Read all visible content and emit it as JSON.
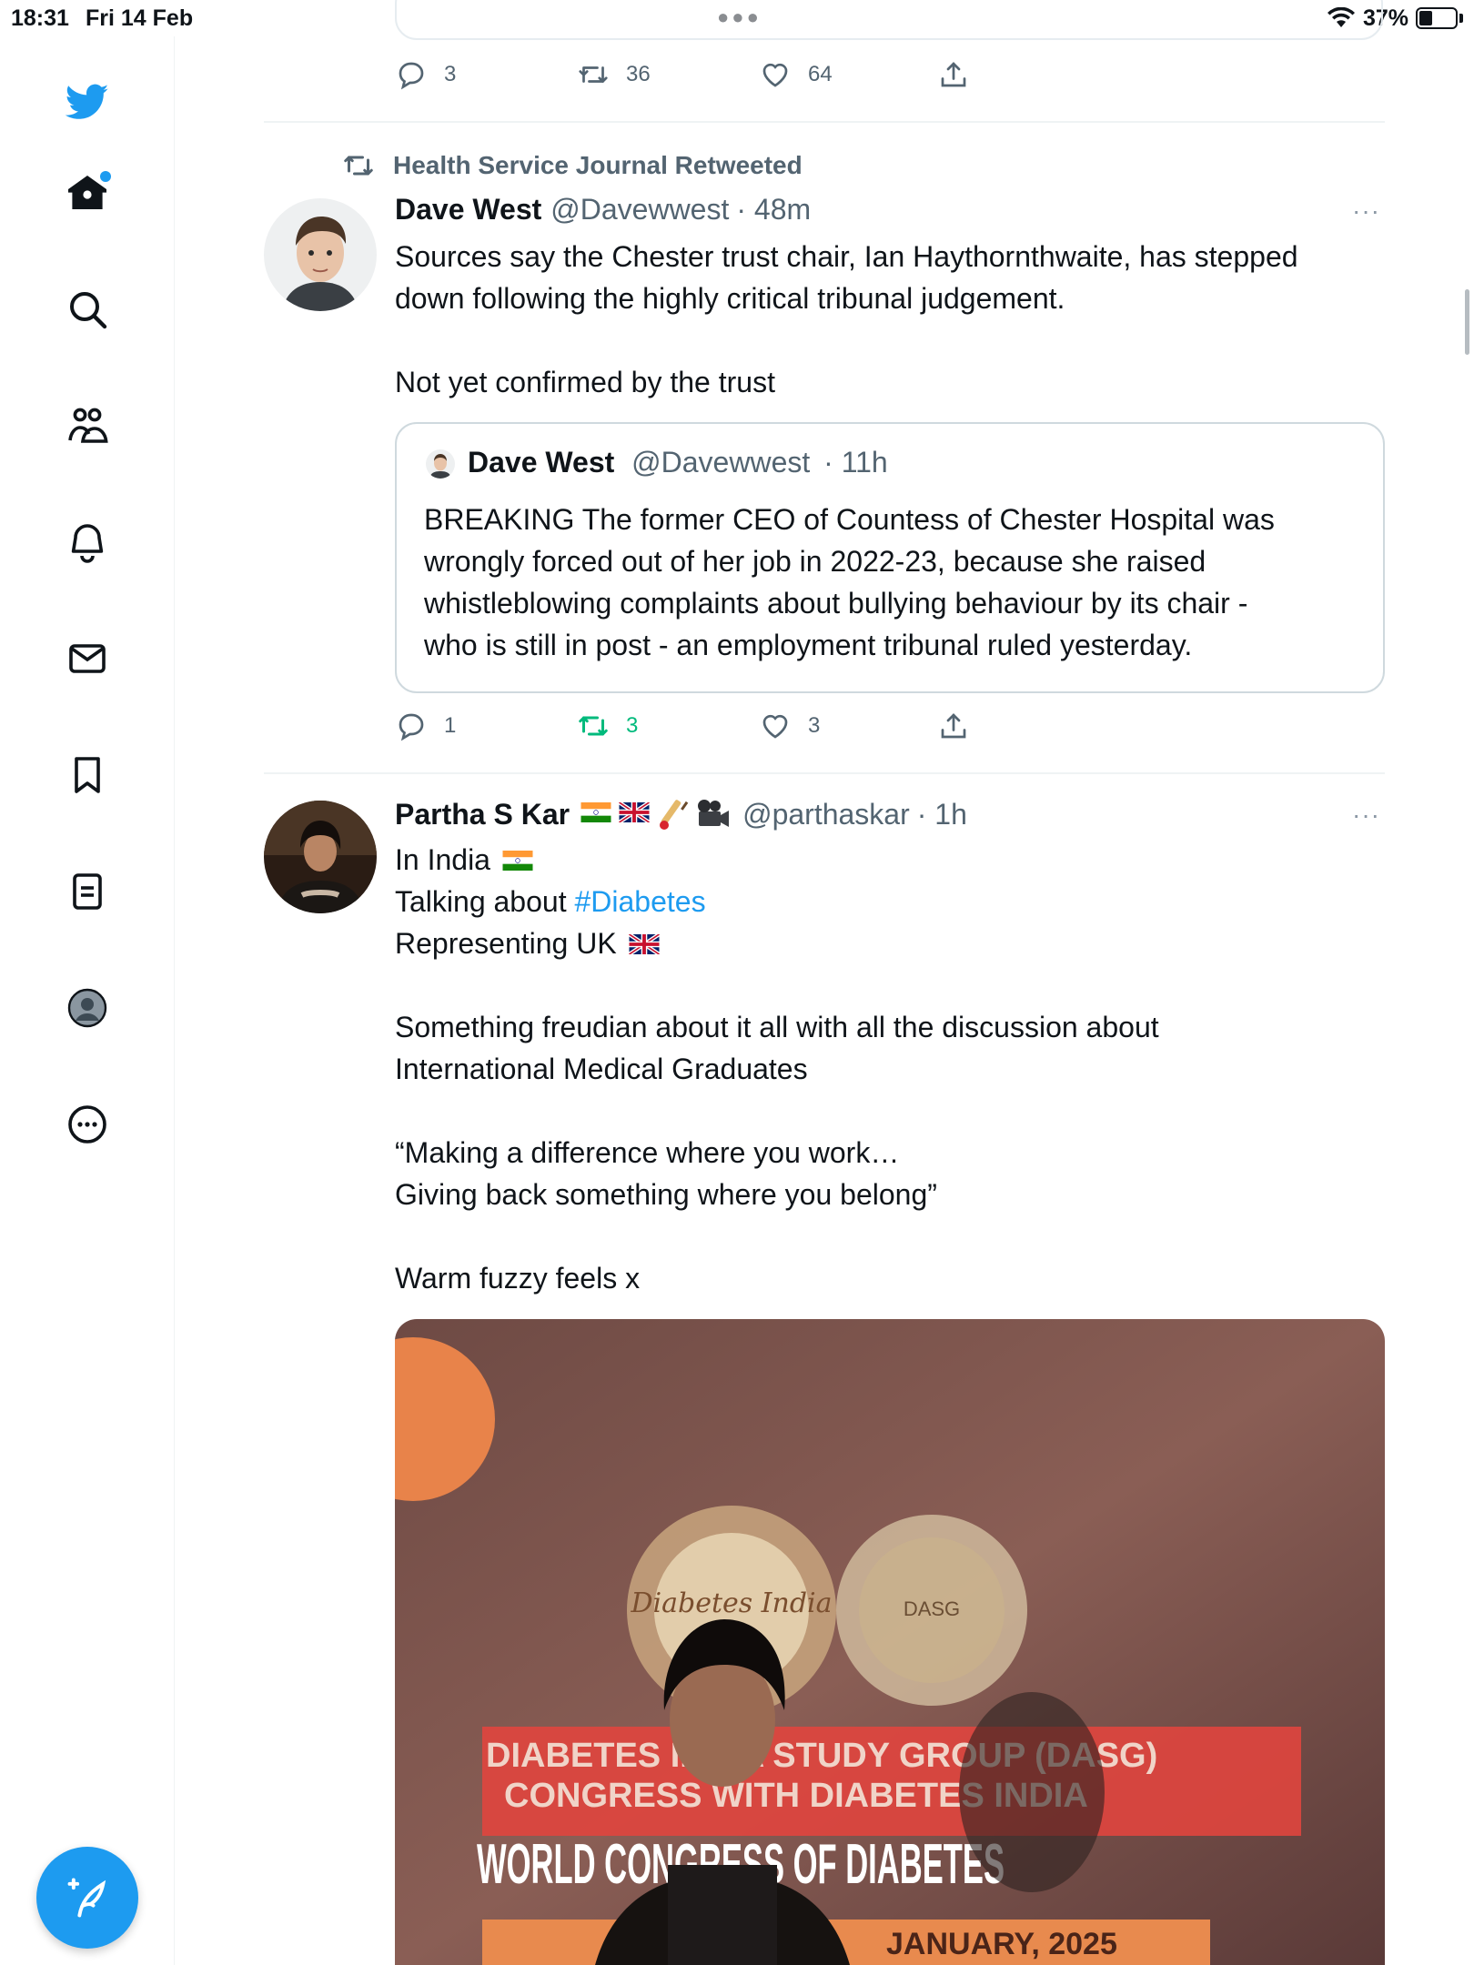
{
  "status_bar": {
    "time": "18:31",
    "date": "Fri 14 Feb",
    "battery": "37%"
  },
  "top_tweet": {
    "replies": "3",
    "retweets": "36",
    "likes": "64"
  },
  "tweet1": {
    "retweeted_by": "Health Service Journal Retweeted",
    "name": "Dave West",
    "handle": "@Davewwest",
    "time": "· 48m",
    "more": "···",
    "text_lines": [
      "Sources say the Chester trust chair, Ian Haythornthwaite, has stepped",
      "down following the highly critical tribunal judgement.",
      "",
      "Not yet confirmed by the trust"
    ],
    "quote": {
      "name": "Dave West",
      "handle": "@Davewwest",
      "time": "· 11h",
      "text_lines": [
        "BREAKING The former CEO of Countess of Chester Hospital was",
        "wrongly forced out of her job in 2022-23, because she raised",
        "whistleblowing complaints about bullying behaviour by its chair -",
        "who is still in post - an employment tribunal ruled yesterday."
      ]
    },
    "replies": "1",
    "retweets": "3",
    "likes": "3"
  },
  "tweet2": {
    "name": "Partha S Kar",
    "handle": "@parthaskar",
    "time": "· 1h",
    "more": "···",
    "line1": "In India",
    "line2_prefix": "Talking about ",
    "hashtag": "#Diabetes",
    "line3": "Representing UK",
    "text_lines": [
      "",
      "Something freudian about it all with all the discussion about",
      "International Medical Graduates",
      "",
      "“Making a difference where you work…",
      "Giving back something where you belong”",
      "",
      "Warm fuzzy feels x"
    ],
    "media": {
      "banner_line1": "DIABETES INDIA STUDY GROUP (DASG)",
      "banner_line2": "CONGRESS WITH DIABETES INDIA",
      "banner_line3": "WORLD CONGRESS OF DIABETES",
      "banner_line4": "JANUARY, 2025",
      "seal_left": "Diabetes India",
      "seal_right": "DASG"
    }
  },
  "colors": {
    "accent": "#1d9bf0",
    "retweet_green": "#00ba7c",
    "secondary": "#536471"
  },
  "icons": [
    "twitter-logo-icon",
    "home-icon",
    "search-icon",
    "communities-icon",
    "notifications-icon",
    "messages-icon",
    "bookmarks-icon",
    "lists-icon",
    "profile-icon",
    "more-icon",
    "compose-icon",
    "reply-icon",
    "retweet-icon",
    "like-icon",
    "share-icon"
  ]
}
